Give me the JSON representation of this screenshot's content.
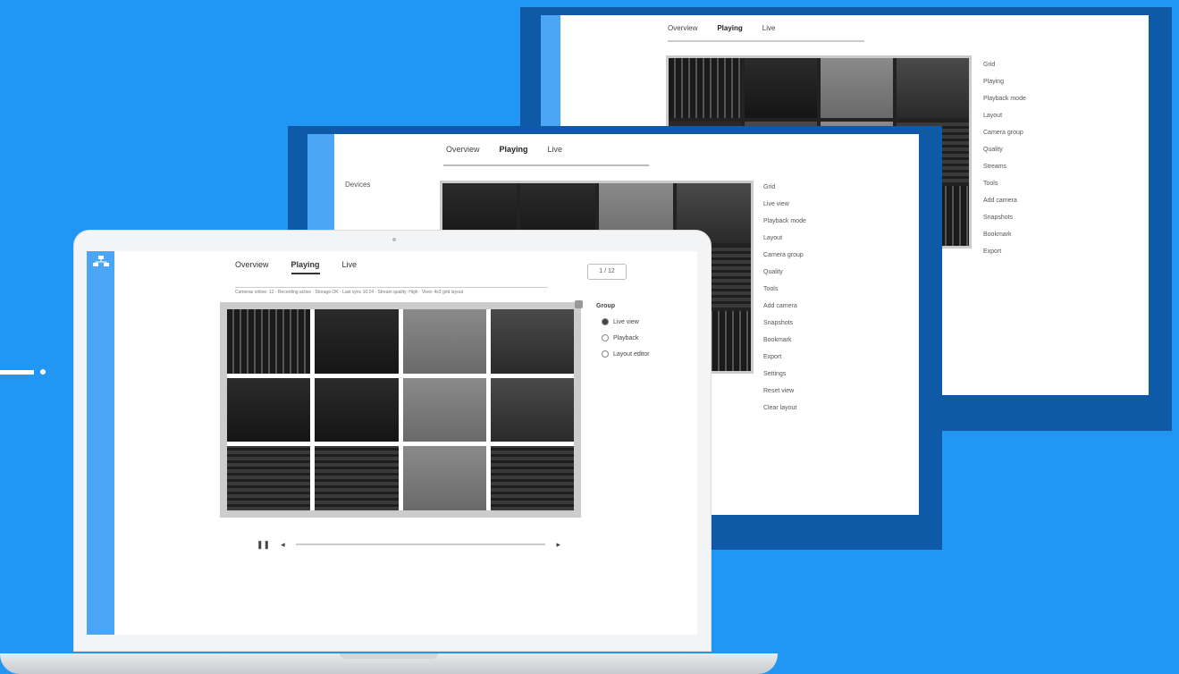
{
  "back_window": {
    "tabs": [
      "Overview",
      "Playing",
      "Live"
    ],
    "panel_labels": [
      "Grid",
      "Playing",
      "Playback mode",
      "Layout",
      "Camera group",
      "Quality",
      "Streams",
      "Tools",
      "Add camera",
      "Snapshots",
      "Bookmark",
      "Export"
    ]
  },
  "mid_window": {
    "tabs": [
      "Overview",
      "Playing",
      "Live"
    ],
    "side_label": "Devices",
    "panel_labels": [
      "Grid",
      "Live view",
      "Playback mode",
      "Layout",
      "Camera group",
      "Quality",
      "Tools",
      "Add camera",
      "Snapshots",
      "Bookmark",
      "Export",
      "Settings",
      "Reset view",
      "Clear layout"
    ]
  },
  "laptop_screen": {
    "tabs": [
      "Overview",
      "Playing",
      "Live"
    ],
    "status_text": "Cameras online: 12 · Recording active · Storage OK · Last sync 10:24 · Stream quality: High · View: 4x3 grid layout",
    "pager_label": "1 / 12",
    "right_panel": {
      "header": "Group",
      "options": [
        "Live view",
        "Playback",
        "Layout editor"
      ],
      "selected_index": 0
    },
    "player": {
      "pause_glyph": "❚❚",
      "prev_glyph": "◂",
      "next_glyph": "▸",
      "progress": 0.0
    }
  },
  "colors": {
    "background": "#2196F3",
    "shadow": "#0f5aa6",
    "sidebar": "#4ba7f6"
  }
}
